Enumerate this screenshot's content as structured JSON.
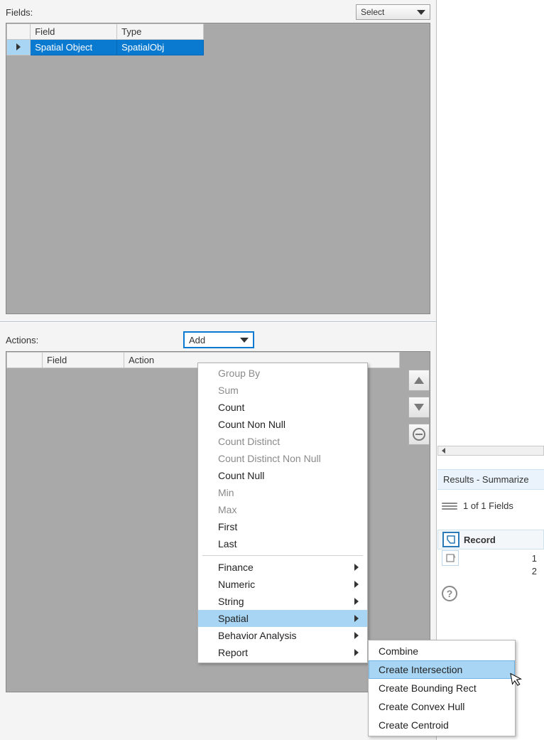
{
  "fields": {
    "label": "Fields:",
    "select_label": "Select",
    "columns": {
      "field": "Field",
      "type": "Type"
    },
    "rows": [
      {
        "field": "Spatial Object",
        "type": "SpatialObj"
      }
    ]
  },
  "actions": {
    "label": "Actions:",
    "add_label": "Add",
    "columns": {
      "field": "Field",
      "action": "Action"
    }
  },
  "menu": {
    "group_by": "Group By",
    "sum": "Sum",
    "count": "Count",
    "count_non_null": "Count Non Null",
    "count_distinct": "Count Distinct",
    "count_distinct_non_null": "Count Distinct Non Null",
    "count_null": "Count Null",
    "min": "Min",
    "max": "Max",
    "first": "First",
    "last": "Last",
    "finance": "Finance",
    "numeric": "Numeric",
    "string": "String",
    "spatial": "Spatial",
    "behavior": "Behavior Analysis",
    "report": "Report"
  },
  "submenu": {
    "combine": "Combine",
    "create_intersection": "Create Intersection",
    "create_bounding_rect": "Create Bounding Rect",
    "create_convex_hull": "Create Convex Hull",
    "create_centroid": "Create Centroid"
  },
  "results": {
    "title": "Results - Summarize",
    "fields_count": "1 of 1 Fields",
    "record_label": "Record",
    "row1": "1",
    "row2": "2",
    "help": "?"
  }
}
